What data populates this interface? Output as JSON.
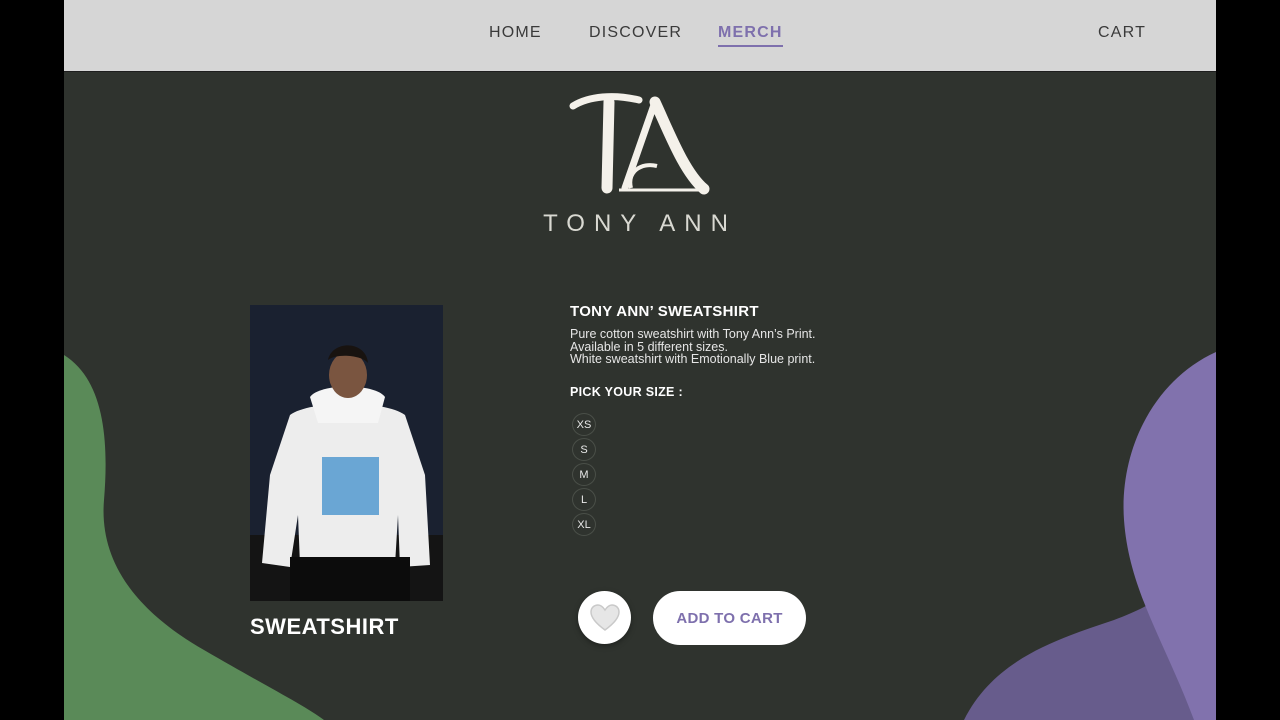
{
  "nav": {
    "links": [
      "HOME",
      "DISCOVER",
      "MERCH"
    ],
    "active": "MERCH",
    "cart_label": "CART"
  },
  "brand": {
    "monogram": "TA",
    "name": "TONY ANN"
  },
  "product": {
    "label": "SWEATSHIRT",
    "title": "TONY ANN’ SWEATSHIRT",
    "description_lines": [
      "Pure cotton sweatshirt with Tony Ann’s Print.",
      "Available in 5 different sizes.",
      "White sweatshirt with Emotionally Blue print."
    ],
    "size_heading": "PICK YOUR SIZE :",
    "sizes": [
      "XS",
      "S",
      "M",
      "L",
      "XL"
    ],
    "add_to_cart_label": "ADD TO CART"
  },
  "colors": {
    "accent": "#7e70ad",
    "background": "#2f332e",
    "green_blob": "#5a8a58",
    "purple_blob": "#8172ad",
    "topbar": "#d6d6d6"
  },
  "icons": {
    "favorite": "heart-icon"
  }
}
